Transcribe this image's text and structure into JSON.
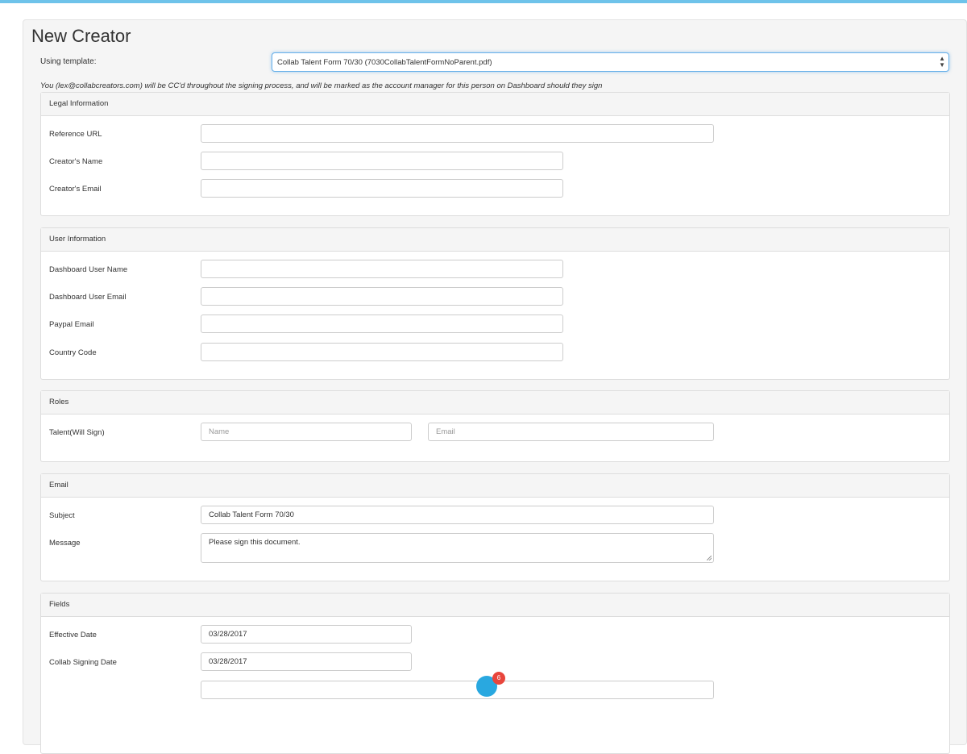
{
  "page": {
    "title": "New Creator"
  },
  "template": {
    "label": "Using template:",
    "selected": "Collab Talent Form 70/30 (7030CollabTalentFormNoParent.pdf)"
  },
  "cc_note": "You (lex@collabcreators.com) will be CC'd throughout the signing process, and will be marked as the account manager for this person on Dashboard should they sign",
  "sections": {
    "legal": {
      "heading": "Legal Information",
      "reference_url": {
        "label": "Reference URL",
        "value": ""
      },
      "creator_name": {
        "label": "Creator's Name",
        "value": ""
      },
      "creator_email": {
        "label": "Creator's Email",
        "value": ""
      }
    },
    "user": {
      "heading": "User Information",
      "dashboard_user_name": {
        "label": "Dashboard User Name",
        "value": ""
      },
      "dashboard_user_email": {
        "label": "Dashboard User Email",
        "value": ""
      },
      "paypal_email": {
        "label": "Paypal Email",
        "value": ""
      },
      "country_code": {
        "label": "Country Code",
        "value": ""
      }
    },
    "roles": {
      "heading": "Roles",
      "talent": {
        "label": "Talent(Will Sign)",
        "name_placeholder": "Name",
        "email_placeholder": "Email"
      }
    },
    "email": {
      "heading": "Email",
      "subject": {
        "label": "Subject",
        "value": "Collab Talent Form 70/30"
      },
      "message": {
        "label": "Message",
        "value": "Please sign this document."
      }
    },
    "fields": {
      "heading": "Fields",
      "effective_date": {
        "label": "Effective Date",
        "value": "03/28/2017"
      },
      "collab_signing_date": {
        "label": "Collab Signing Date",
        "value": "03/28/2017"
      }
    }
  },
  "chat": {
    "badge_count": "6",
    "icon": "chat-bubble-icon",
    "color": "#29a8e0",
    "badge_color": "#e8453c"
  },
  "colors": {
    "accent": "#6ec3ea",
    "focus": "#66afe9"
  }
}
